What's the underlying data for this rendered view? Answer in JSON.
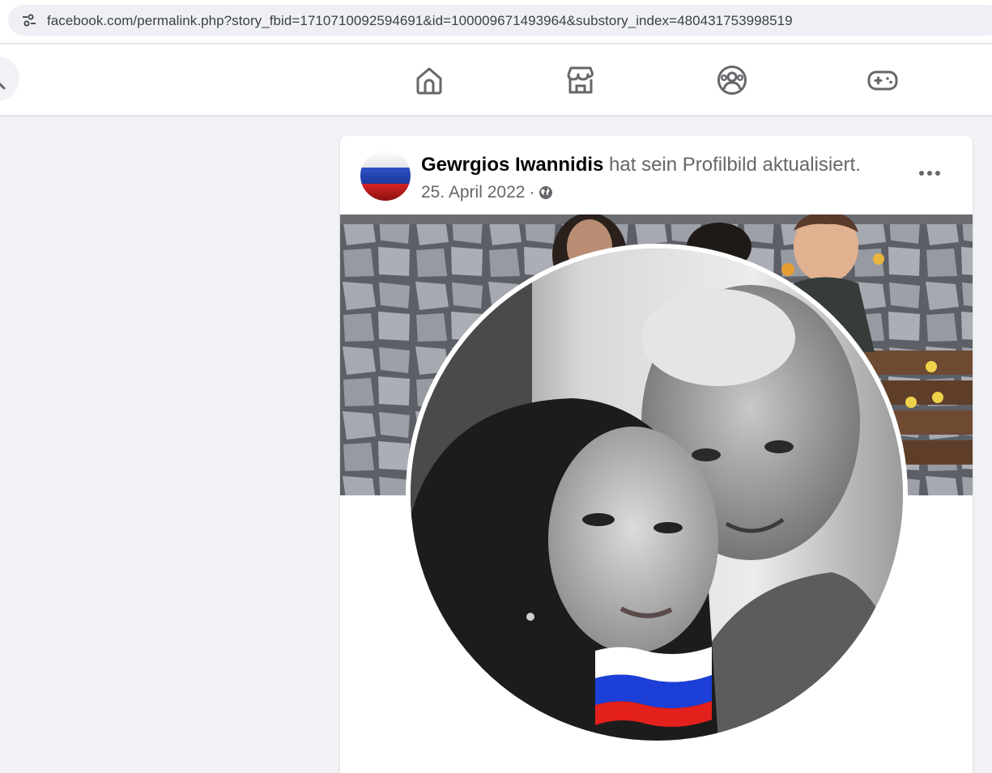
{
  "browser": {
    "url": "facebook.com/permalink.php?story_fbid=1710710092594691&id=100009671493964&substory_index=480431753998519",
    "site_info_icon": "tune-icon"
  },
  "nav": {
    "icons": [
      "search-icon",
      "home-icon",
      "marketplace-icon",
      "groups-icon",
      "gaming-icon"
    ]
  },
  "post": {
    "author": "Gewrgios Iwannidis",
    "action": "hat sein Profilbild aktualisiert.",
    "date": "25. April 2022",
    "separator": "·",
    "privacy_icon": "globe-icon",
    "more_icon": "more-horizontal-icon"
  },
  "colors": {
    "flag_white": "#ffffff",
    "flag_blue": "#1c3fd8",
    "flag_red": "#e3201b",
    "text_primary": "#050505",
    "text_secondary": "#65676b",
    "icon_gray": "#65676b"
  }
}
